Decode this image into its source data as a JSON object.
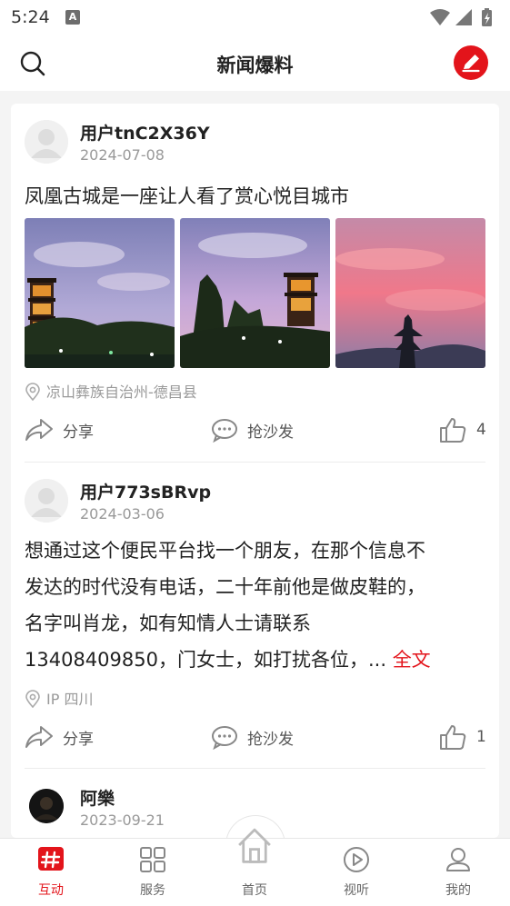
{
  "status_bar": {
    "time": "5:24",
    "a_icon": "A"
  },
  "header": {
    "title": "新闻爆料",
    "search_icon": "search-icon",
    "post_icon": "pencil-icon"
  },
  "posts": [
    {
      "username": "用户tnC2X36Y",
      "date": "2024-07-08",
      "content": "凤凰古城是一座让人看了赏心悦目城市",
      "images": [
        "pagoda-at-dusk",
        "pagoda-with-trees",
        "pink-sunset-sky"
      ],
      "location": "凉山彝族自治州-德昌县",
      "share": "分享",
      "comment": "抢沙发",
      "likes": "4"
    },
    {
      "username": "用户773sBRvp",
      "date": "2024-03-06",
      "content_lines": [
        "想通过这个便民平台找一个朋友，在那个信息不",
        "发达的时代没有电话，二十年前他是做皮鞋的，",
        "名字叫肖龙，如有知情人士请联系",
        "13408409850，门女士，如打扰各位，..."
      ],
      "more": "全文",
      "location": "IP 四川",
      "share": "分享",
      "comment": "抢沙发",
      "likes": "1"
    },
    {
      "username": "阿樂",
      "date": "2023-09-21"
    }
  ],
  "tabbar": [
    {
      "label": "互动",
      "icon": "hash-icon",
      "active": true
    },
    {
      "label": "服务",
      "icon": "grid-icon",
      "active": false
    },
    {
      "label": "首页",
      "icon": "home-icon",
      "active": false
    },
    {
      "label": "视听",
      "icon": "play-icon",
      "active": false
    },
    {
      "label": "我的",
      "icon": "user-icon",
      "active": false
    }
  ],
  "colors": {
    "accent": "#e3141b",
    "text": "#222222",
    "muted": "#999999",
    "background": "#f4f4f4"
  }
}
